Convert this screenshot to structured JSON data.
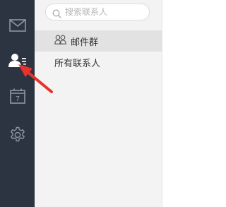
{
  "sidebar": {
    "nav_icons": [
      "mail-icon",
      "contacts-icon",
      "calendar-icon",
      "settings-icon"
    ],
    "calendar_day": "7"
  },
  "search": {
    "placeholder": "搜索联系人"
  },
  "contacts": {
    "items": [
      {
        "label": "邮件群",
        "icon": "group-icon",
        "selected": true
      },
      {
        "label": "所有联系人",
        "selected": false
      }
    ]
  },
  "colors": {
    "sidebar_bg": "#2d3441",
    "panel_bg": "#f3f3f3",
    "selected_bg": "#e2e2e2",
    "active_icon": "#ffffff",
    "inactive_icon": "#8e96a3",
    "annotation_arrow": "#e8322e"
  }
}
